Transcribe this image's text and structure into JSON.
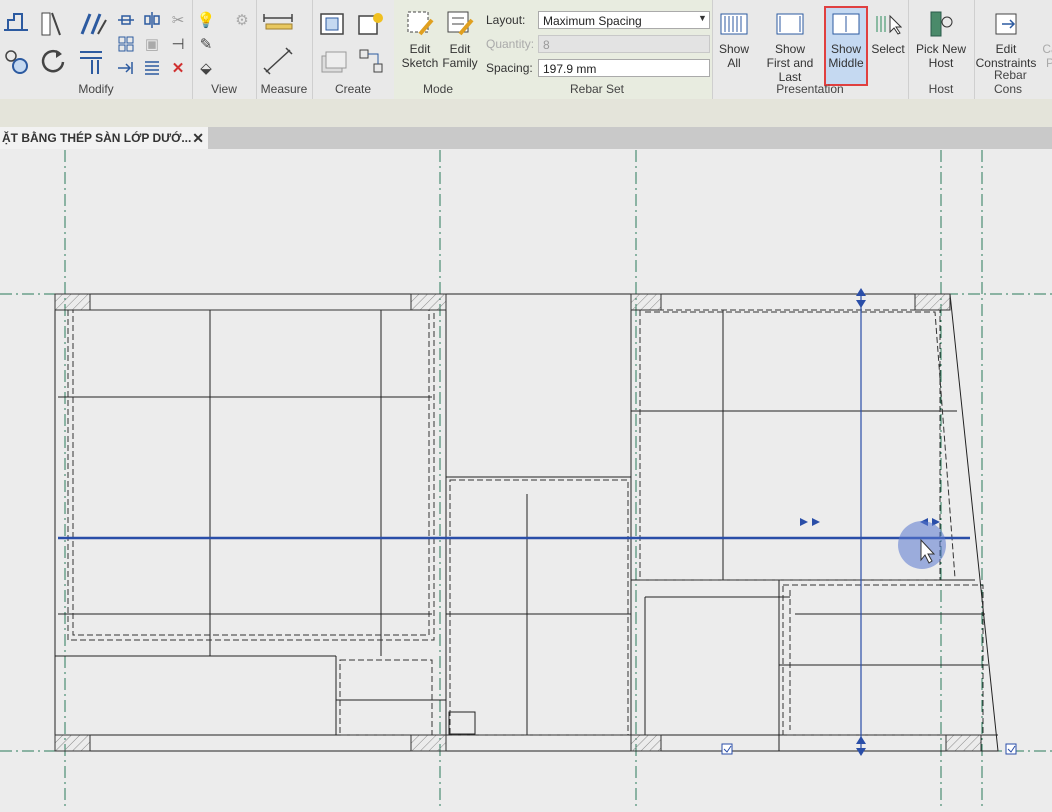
{
  "ribbon": {
    "panels": {
      "modify": "Modify",
      "view": "View",
      "measure": "Measure",
      "create": "Create",
      "mode": "Mode",
      "rebar_set": "Rebar Set",
      "presentation": "Presentation",
      "host": "Host",
      "rebar_constraints": "Rebar Cons"
    },
    "mode": {
      "edit_sketch": [
        "Edit",
        "Sketch"
      ],
      "edit_family": [
        "Edit",
        "Family"
      ]
    },
    "rebar_set": {
      "layout_label": "Layout:",
      "layout_value": "Maximum Spacing",
      "quantity_label": "Quantity:",
      "quantity_value": "8",
      "spacing_label": "Spacing:",
      "spacing_value": "197.9 mm"
    },
    "presentation": {
      "show_all": [
        "Show",
        "All"
      ],
      "show_first_last": [
        "Show",
        "First and Last"
      ],
      "show_middle": [
        "Show",
        "Middle"
      ],
      "select": "Select"
    },
    "host": {
      "pick_new_host": [
        "Pick New",
        "Host"
      ]
    },
    "constraints": {
      "edit_constraints": [
        "Edit",
        "Constraints"
      ],
      "partial": [
        "Ca",
        "P"
      ]
    }
  },
  "document_tab": {
    "title": "ẶT BẰNG THÉP SÀN LỚP DƯỚ...",
    "close": "✕"
  },
  "colors": {
    "highlight_red": "#e04040",
    "active_blue": "#c5d9f1",
    "rebar_blue": "#2a4ea8",
    "grid_green": "#2a7a5a"
  },
  "icons": [
    "align-icon",
    "split-icon",
    "trim-icon",
    "offset-icon",
    "mirror-icon",
    "move-icon",
    "copy-icon",
    "rotate-icon",
    "array-icon",
    "scale-icon",
    "pin-icon",
    "delete-icon",
    "paint-icon",
    "view-icon",
    "measure-icon",
    "create-icon",
    "cursor-icon"
  ]
}
